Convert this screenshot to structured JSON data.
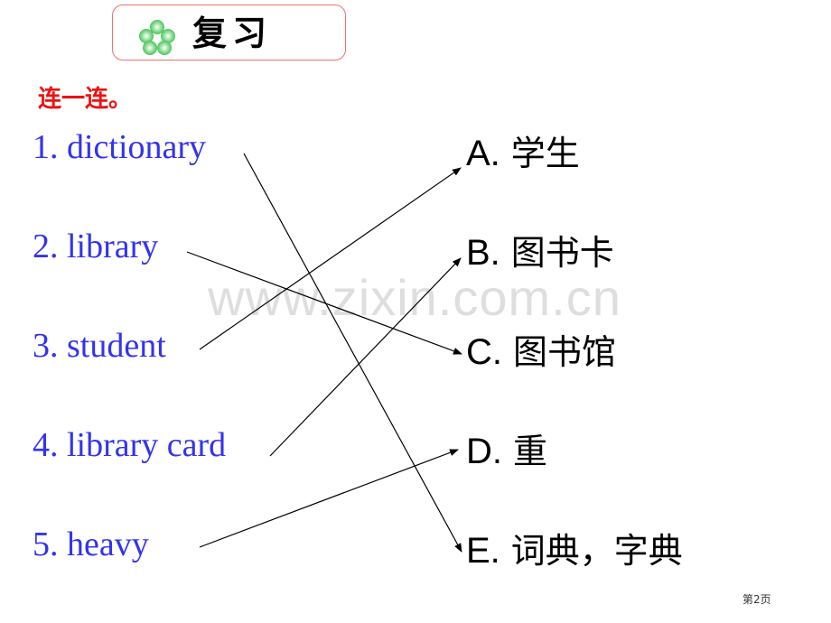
{
  "header": {
    "icon": "clover-icon",
    "title": "复习"
  },
  "instruction": "连一连。",
  "left_items": [
    {
      "label": "1. dictionary"
    },
    {
      "label": "2. library"
    },
    {
      "label": "3. student"
    },
    {
      "label": "4. library card"
    },
    {
      "label": "5. heavy"
    }
  ],
  "right_items": [
    {
      "letter": "A.",
      "text": "学生"
    },
    {
      "letter": "B.",
      "text": "图书卡"
    },
    {
      "letter": "C.",
      "text": "图书馆"
    },
    {
      "letter": "D.",
      "text": "重"
    },
    {
      "letter": "E.",
      "text": "词典，字典"
    }
  ],
  "matches": [
    {
      "from": "1. dictionary",
      "to": "E."
    },
    {
      "from": "2. library",
      "to": "C."
    },
    {
      "from": "3. student",
      "to": "A."
    },
    {
      "from": "4. library card",
      "to": "B."
    },
    {
      "from": "5. heavy",
      "to": "D."
    }
  ],
  "watermark": "www.zixin.com.cn",
  "footer": {
    "page_label": "第2页"
  },
  "colors": {
    "english_text": "#3333ee",
    "instruction_text": "#ee1111",
    "title_border": "#f07070",
    "clover": "#44cc55"
  }
}
